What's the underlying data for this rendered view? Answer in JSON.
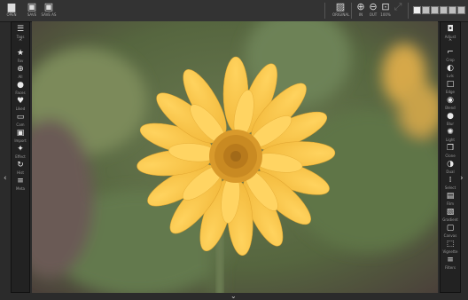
{
  "toolbar": {
    "open": {
      "icon": "folder-icon",
      "label": "OPEN"
    },
    "save": {
      "icon": "save-icon",
      "label": "SAVE"
    },
    "save_as": {
      "icon": "save-as-icon",
      "label": "SAVE AS"
    },
    "original": {
      "icon": "image-icon",
      "label": "ORIGINAL"
    },
    "zoom_in": {
      "icon": "zoom-in-icon",
      "label": "IN"
    },
    "zoom_out": {
      "icon": "zoom-out-icon",
      "label": "OUT"
    },
    "zoom_fit": {
      "icon": "fit-icon",
      "label": "100%"
    },
    "fullscreen": {
      "icon": "expand-icon",
      "label": ""
    }
  },
  "left_sidebar": {
    "top": {
      "icon": "layers-icon",
      "label": "Tags"
    },
    "items": [
      {
        "icon": "star-icon",
        "label": "Fav"
      },
      {
        "icon": "target-icon",
        "label": "All"
      },
      {
        "icon": "person-icon",
        "label": "Faces"
      },
      {
        "icon": "heart-icon",
        "label": "Liked"
      },
      {
        "icon": "camera-icon",
        "label": "Cam"
      },
      {
        "icon": "frame-icon",
        "label": "Import"
      },
      {
        "icon": "sparkle-icon",
        "label": "Effect"
      },
      {
        "icon": "history-icon",
        "label": "Hist"
      },
      {
        "icon": "menu-icon",
        "label": "Meta"
      }
    ]
  },
  "right_sidebar": {
    "top": {
      "icon": "camera-icon",
      "label": "Adjust"
    },
    "items": [
      {
        "icon": "crop-icon",
        "label": "Crop"
      },
      {
        "icon": "levels-icon",
        "label": "Lvls"
      },
      {
        "icon": "square-icon",
        "label": "Edge"
      },
      {
        "icon": "circle-icon",
        "label": "Blend"
      },
      {
        "icon": "dot-icon",
        "label": "Blur"
      },
      {
        "icon": "sun-icon",
        "label": "Light"
      },
      {
        "icon": "copy-icon",
        "label": "Clone"
      },
      {
        "icon": "contrast-icon",
        "label": "Dual"
      },
      {
        "icon": "grid-icon",
        "label": "Select"
      },
      {
        "icon": "film-icon",
        "label": "Film"
      },
      {
        "icon": "gradient-icon",
        "label": "Gradient"
      },
      {
        "icon": "picture-icon",
        "label": "Canvas"
      },
      {
        "icon": "vignette-icon",
        "label": "Vignette"
      },
      {
        "icon": "list-icon",
        "label": "Filters"
      }
    ]
  }
}
